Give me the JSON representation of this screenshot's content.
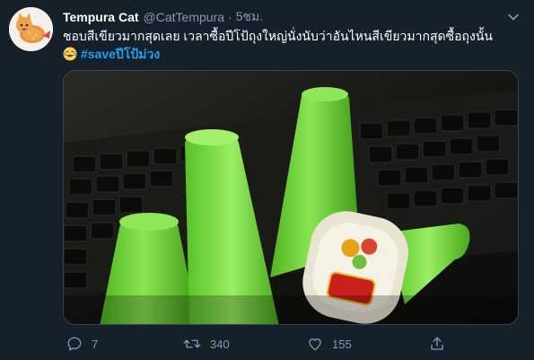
{
  "tweet": {
    "display_name": "Tempura Cat",
    "handle": "@CatTempura",
    "separator": "·",
    "time": "5ชม.",
    "text_line1": "ชอบสีเขียวมากสุดเลย เวลาซื้อปีโป้ถุงใหญ่นั่งนับว่าอันไหนสีเขียวมากสุดซื้อถุงนั้น",
    "emoji": "😂",
    "hashtag": "#saveปีโป้ม่วง"
  },
  "actions": {
    "reply_count": "7",
    "retweet_count": "340",
    "like_count": "155"
  },
  "icons": {
    "avatar": "cat-avatar-icon",
    "more": "chevron-down-icon",
    "reply": "reply-icon",
    "retweet": "retweet-icon",
    "like": "heart-icon",
    "share": "share-icon"
  },
  "colors": {
    "background": "#15202b",
    "hashtag": "#1da1f2",
    "muted": "#8899a6",
    "jelly_green": "#6fd43c"
  }
}
